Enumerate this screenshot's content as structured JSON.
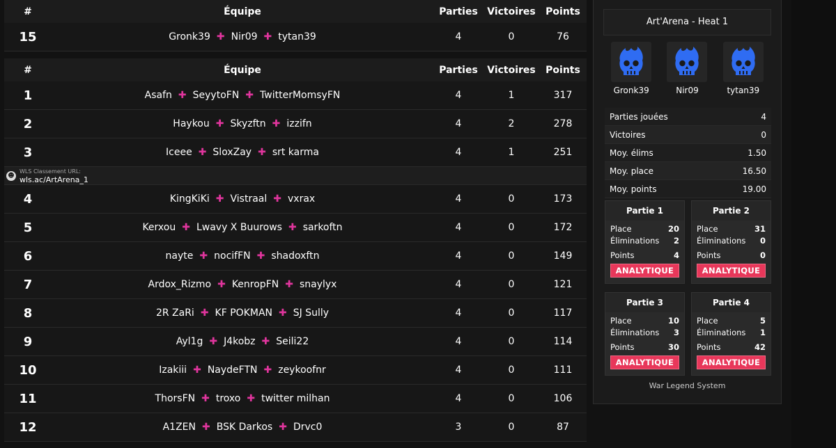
{
  "top_table": {
    "headers": {
      "rank": "#",
      "team": "Équipe",
      "games": "Parties",
      "wins": "Victoires",
      "points": "Points"
    },
    "row": {
      "rank": "15",
      "players": [
        "Gronk39",
        "Nir09",
        "tytan39"
      ],
      "games": "4",
      "wins": "0",
      "points": "76"
    }
  },
  "main_table": {
    "headers": {
      "rank": "#",
      "team": "Équipe",
      "games": "Parties",
      "wins": "Victoires",
      "points": "Points"
    },
    "rows_a": [
      {
        "rank": "1",
        "players": [
          "Asafn",
          "SeyytoFN",
          "TwitterMomsyFN"
        ],
        "games": "4",
        "wins": "1",
        "points": "317"
      },
      {
        "rank": "2",
        "players": [
          "Haykou",
          "Skyzftn",
          "izzifn"
        ],
        "games": "4",
        "wins": "2",
        "points": "278"
      },
      {
        "rank": "3",
        "players": [
          "Iceee",
          "SloxZay",
          "srt karma"
        ],
        "games": "4",
        "wins": "1",
        "points": "251"
      }
    ],
    "url_bar": {
      "label": "WLS Classement URL:",
      "value": "wls.ac/ArtArena_1"
    },
    "rows_b": [
      {
        "rank": "4",
        "players": [
          "KingKiKi",
          "Vistraal",
          "vxrax"
        ],
        "games": "4",
        "wins": "0",
        "points": "173"
      },
      {
        "rank": "5",
        "players": [
          "Kerxou",
          "Lwavy X Buurows",
          "sarkoftn"
        ],
        "games": "4",
        "wins": "0",
        "points": "172"
      },
      {
        "rank": "6",
        "players": [
          "nayte",
          "nocifFN",
          "shadoxftn"
        ],
        "games": "4",
        "wins": "0",
        "points": "149"
      },
      {
        "rank": "7",
        "players": [
          "Ardox_Rizmo",
          "KenropFN",
          "snaylyx"
        ],
        "games": "4",
        "wins": "0",
        "points": "121"
      },
      {
        "rank": "8",
        "players": [
          "2R ZaRi",
          "KF POKMAN",
          "SJ Sully"
        ],
        "games": "4",
        "wins": "0",
        "points": "117"
      },
      {
        "rank": "9",
        "players": [
          "Ayl1g",
          "J4kobz",
          "Seili22"
        ],
        "games": "4",
        "wins": "0",
        "points": "114"
      },
      {
        "rank": "10",
        "players": [
          "Izakiii",
          "NaydeFTN",
          "zeykoofnr"
        ],
        "games": "4",
        "wins": "0",
        "points": "111"
      },
      {
        "rank": "11",
        "players": [
          "ThorsFN",
          "troxo",
          "twitter milhan"
        ],
        "games": "4",
        "wins": "0",
        "points": "106"
      },
      {
        "rank": "12",
        "players": [
          "A1ZEN",
          "BSK Darkos",
          "Drvc0"
        ],
        "games": "3",
        "wins": "0",
        "points": "87"
      }
    ]
  },
  "panel": {
    "title": "Art'Arena - Heat 1",
    "players": [
      {
        "name": "Gronk39",
        "icon": "flame-skull-icon"
      },
      {
        "name": "Nir09",
        "icon": "flame-skull-icon"
      },
      {
        "name": "tytan39",
        "icon": "flame-skull-icon"
      }
    ],
    "stats": [
      {
        "label": "Parties jouées",
        "value": "4"
      },
      {
        "label": "Victoires",
        "value": "0"
      },
      {
        "label": "Moy. élims",
        "value": "1.50"
      },
      {
        "label": "Moy. place",
        "value": "16.50"
      },
      {
        "label": "Moy. points",
        "value": "19.00"
      }
    ],
    "games": [
      {
        "title": "Partie 1",
        "place": "20",
        "elims": "2",
        "points": "4"
      },
      {
        "title": "Partie 2",
        "place": "31",
        "elims": "0",
        "points": "0"
      },
      {
        "title": "Partie 3",
        "place": "10",
        "elims": "3",
        "points": "30"
      },
      {
        "title": "Partie 4",
        "place": "5",
        "elims": "1",
        "points": "42"
      }
    ],
    "labels": {
      "place": "Place",
      "elims": "Éliminations",
      "points": "Points",
      "button": "ANALYTIQUE"
    },
    "footer": "War Legend System"
  },
  "colors": {
    "accent_plus": "#e0359d",
    "button": "#e8375a",
    "flame": "#2f6cf2"
  }
}
